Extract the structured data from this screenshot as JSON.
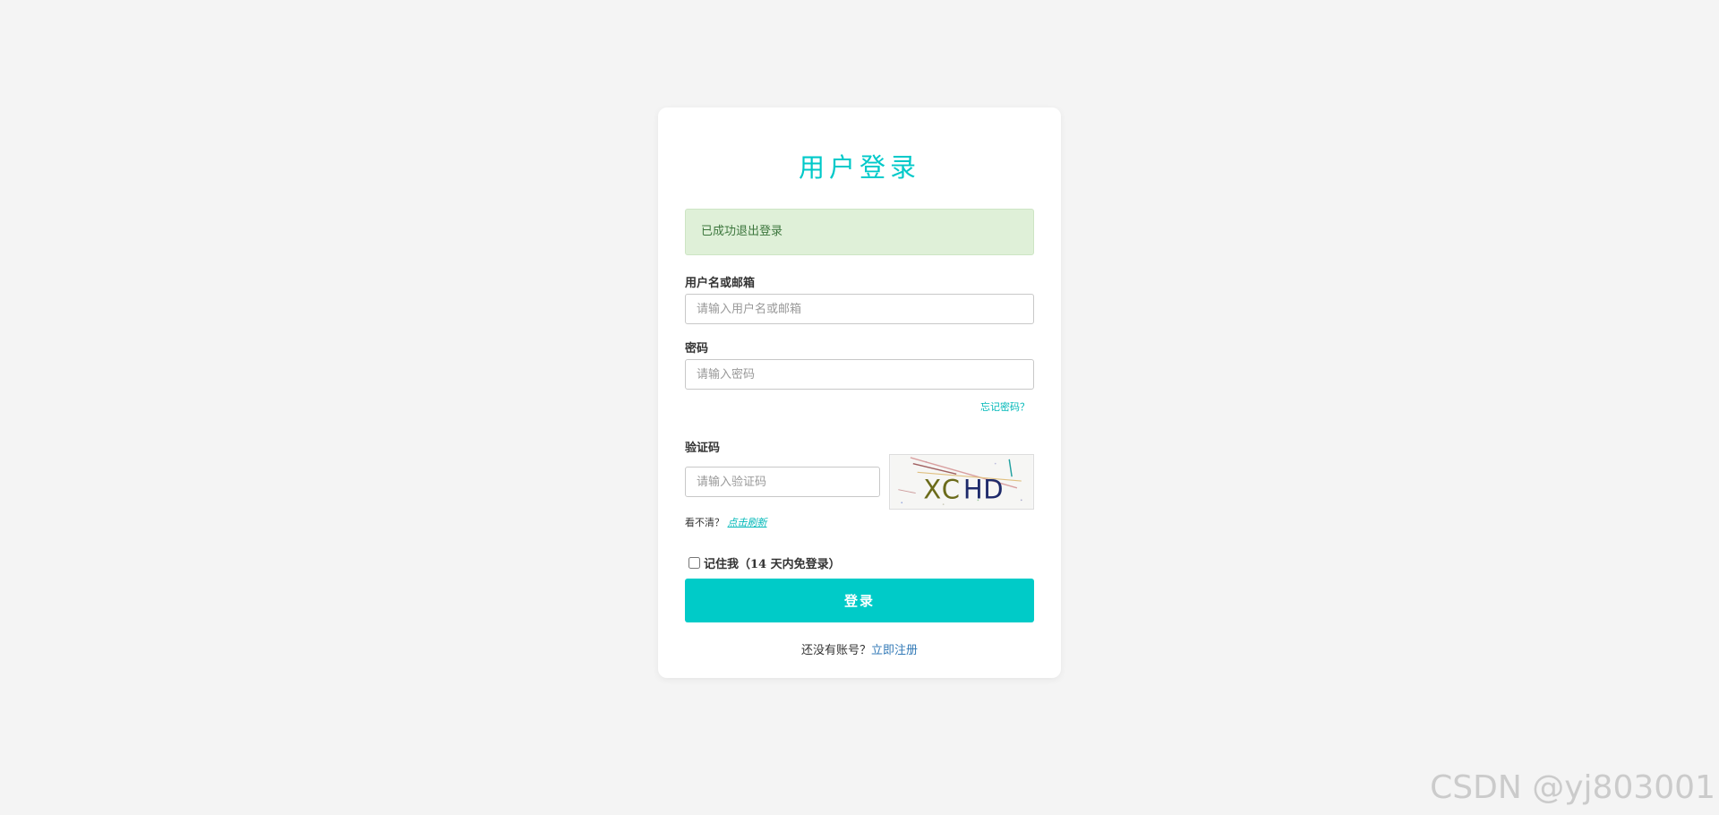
{
  "card": {
    "title": "用户登录",
    "alert": "已成功退出登录"
  },
  "form": {
    "username": {
      "label": "用户名或邮箱",
      "placeholder": "请输入用户名或邮箱",
      "value": ""
    },
    "password": {
      "label": "密码",
      "placeholder": "请输入密码",
      "value": ""
    },
    "forgot_link": "忘记密码？",
    "captcha": {
      "label": "验证码",
      "placeholder": "请输入验证码",
      "image_text": "XCHD",
      "unclear_text": "看不清？",
      "refresh_link": "点击刷新"
    },
    "remember_label": "记住我（14 天内免登录）",
    "remember_checked": false,
    "submit_label": "登录",
    "register_prompt": "还没有账号？",
    "register_link": "立即注册"
  },
  "colors": {
    "accent": "#00cbc8",
    "alert_bg": "#dff0d8",
    "alert_text": "#3c763d",
    "link_blue": "#337ab7"
  },
  "watermark": "CSDN @yj803001"
}
